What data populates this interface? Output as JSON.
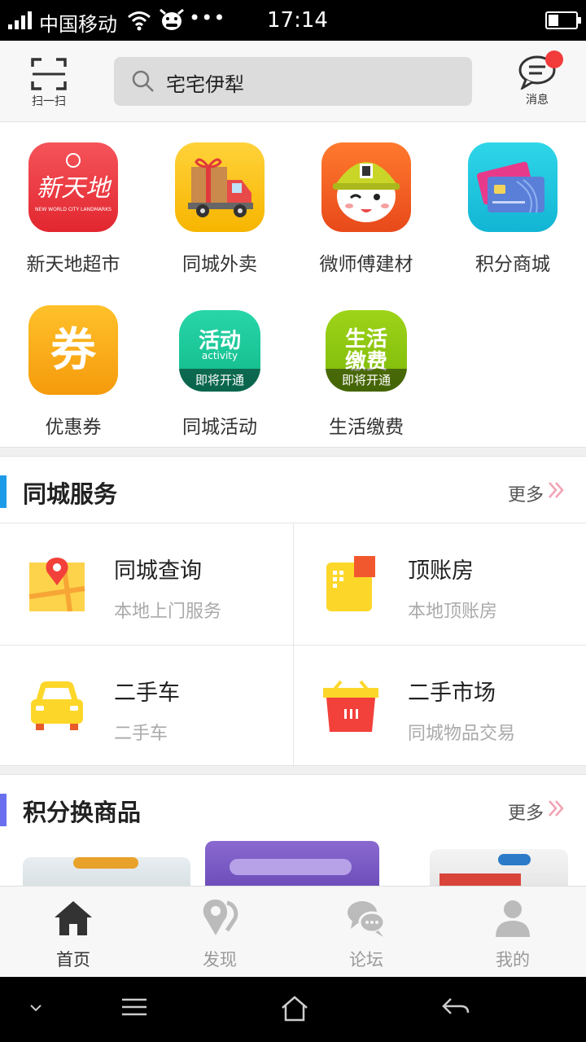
{
  "status_bar": {
    "carrier": "中国移动",
    "dots": "•••",
    "time": "17:14"
  },
  "header": {
    "scan_label": "扫一扫",
    "search_text": "宅宅伊犁",
    "message_label": "消息"
  },
  "apps": [
    {
      "name": "新天地超市",
      "icon": "new-world-supermarket-icon",
      "logo_text": "新天地",
      "logo_sub": "NEW WORLD CITY LANDMARKS"
    },
    {
      "name": "同城外卖",
      "icon": "delivery-truck-icon"
    },
    {
      "name": "微师傅建材",
      "icon": "worker-helmet-icon"
    },
    {
      "name": "积分商城",
      "icon": "credit-card-icon"
    },
    {
      "name": "优惠券",
      "icon": "coupon-icon",
      "logo_text": "券"
    },
    {
      "name": "同城活动",
      "icon": "activity-icon",
      "logo_text": "活动",
      "logo_sub": "activity",
      "badge": "即将开通"
    },
    {
      "name": "生活缴费",
      "icon": "bill-payment-icon",
      "logo_text": "生活",
      "logo_text2": "缴费",
      "badge": "即将开通"
    }
  ],
  "city_services": {
    "title": "同城服务",
    "more": "更多",
    "accent": "#1e9be8",
    "items": [
      {
        "title": "同城查询",
        "subtitle": "本地上门服务",
        "icon": "map-pin-icon"
      },
      {
        "title": "顶账房",
        "subtitle": "本地顶账房",
        "icon": "building-icon"
      },
      {
        "title": "二手车",
        "subtitle": "二手车",
        "icon": "car-icon"
      },
      {
        "title": "二手市场",
        "subtitle": "同城物品交易",
        "icon": "basket-icon"
      }
    ]
  },
  "points_goods": {
    "title": "积分换商品",
    "more": "更多",
    "accent": "#6a6ff0"
  },
  "tabbar": {
    "items": [
      {
        "label": "首页",
        "icon": "home-icon",
        "active": true
      },
      {
        "label": "发现",
        "icon": "discover-pin-icon",
        "active": false
      },
      {
        "label": "论坛",
        "icon": "forum-chat-icon",
        "active": false
      },
      {
        "label": "我的",
        "icon": "profile-icon",
        "active": false
      }
    ]
  }
}
